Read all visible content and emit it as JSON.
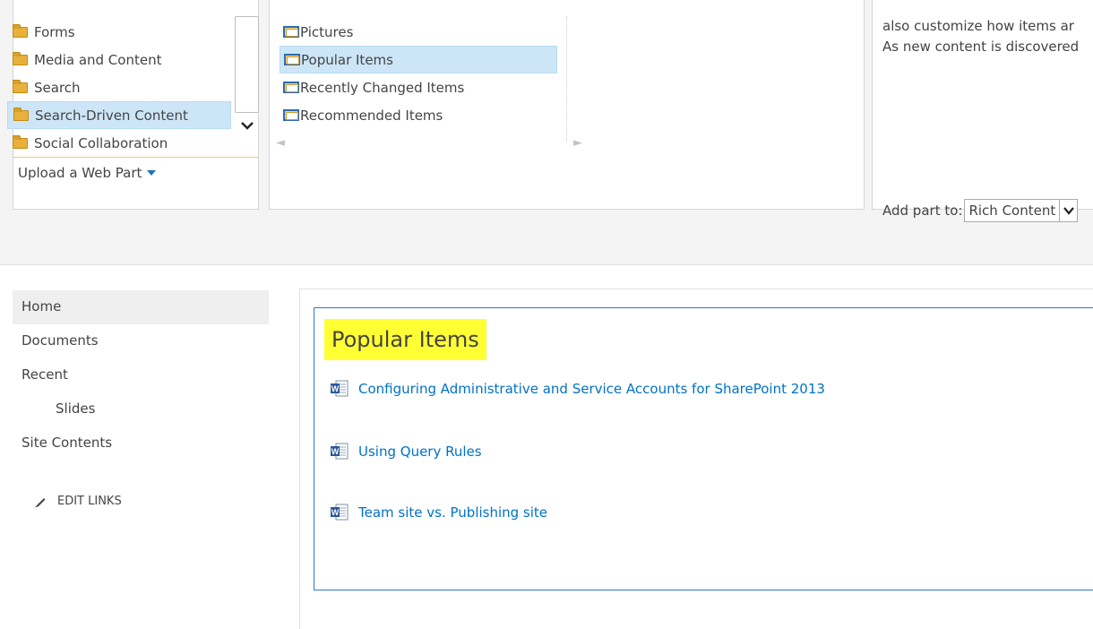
{
  "adder": {
    "categories": [
      "Forms",
      "Media and Content",
      "Search",
      "Search-Driven Content",
      "Social Collaboration"
    ],
    "selected_category": "Search-Driven Content",
    "upload_label": "Upload a Web Part",
    "parts": [
      "Pictures",
      "Popular Items",
      "Recently Changed Items",
      "Recommended Items"
    ],
    "selected_part": "Popular Items",
    "about_lines": [
      "also customize how items ar",
      "As new content is discovered"
    ],
    "add_to_label": "Add part to:",
    "add_to_value": "Rich Content"
  },
  "quicklaunch": {
    "items": [
      "Home",
      "Documents",
      "Recent",
      "Slides",
      "Site Contents"
    ],
    "edit_links": "EDIT LINKS"
  },
  "webpart": {
    "title": "Popular Items",
    "results": [
      "Configuring Administrative and Service Accounts for SharePoint 2013",
      "Using Query Rules",
      "Team site vs. Publishing site"
    ]
  },
  "colors": {
    "selection": "#cde6f7",
    "link": "#0072c6",
    "highlight": "#ffff33",
    "webpart_border": "#2b78c7"
  },
  "icons": [
    "folder-icon",
    "webpart-icon",
    "chevron-down-icon",
    "arrow-left-icon",
    "arrow-right-icon",
    "pencil-icon",
    "word-document-icon"
  ]
}
